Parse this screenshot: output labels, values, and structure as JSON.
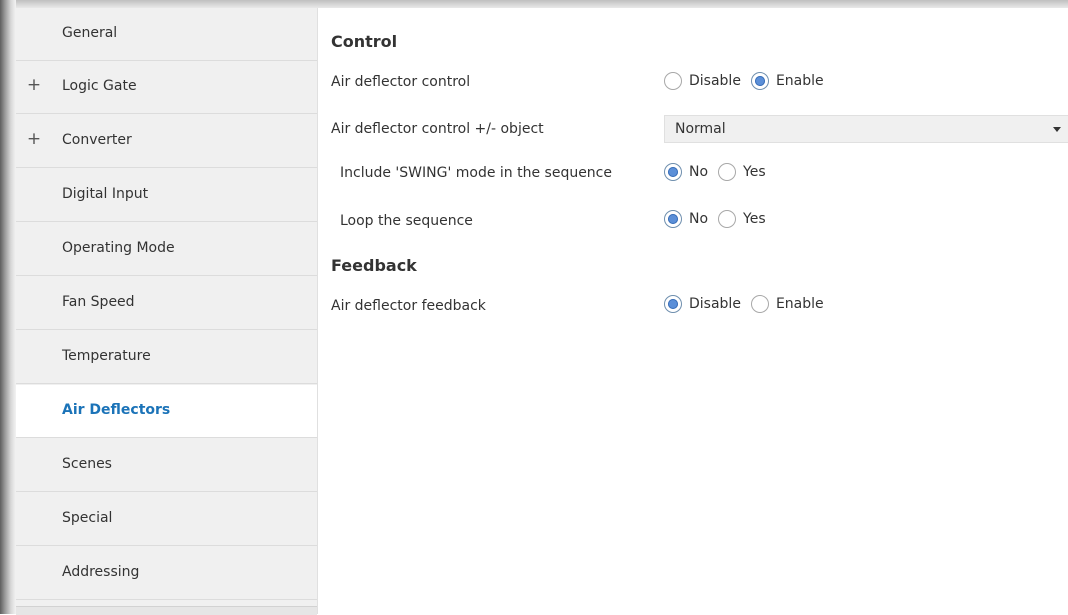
{
  "sidebar": {
    "items": [
      {
        "label": "General",
        "expand": ""
      },
      {
        "label": "Logic Gate",
        "expand": "+"
      },
      {
        "label": "Converter",
        "expand": "+"
      },
      {
        "label": "Digital Input",
        "expand": ""
      },
      {
        "label": "Operating Mode",
        "expand": ""
      },
      {
        "label": "Fan Speed",
        "expand": ""
      },
      {
        "label": "Temperature",
        "expand": ""
      },
      {
        "label": "Air Deflectors",
        "expand": ""
      },
      {
        "label": "Scenes",
        "expand": ""
      },
      {
        "label": "Special",
        "expand": ""
      },
      {
        "label": "Addressing",
        "expand": ""
      }
    ],
    "active_index": 7
  },
  "main": {
    "control": {
      "title": "Control",
      "deflector_control": {
        "label": "Air deflector control",
        "options": [
          "Disable",
          "Enable"
        ],
        "selected": "Enable"
      },
      "pm_object": {
        "label": "Air deflector control +/- object",
        "value": "Normal"
      },
      "swing": {
        "label": "Include 'SWING' mode in the sequence",
        "options": [
          "No",
          "Yes"
        ],
        "selected": "No"
      },
      "loop": {
        "label": "Loop the sequence",
        "options": [
          "No",
          "Yes"
        ],
        "selected": "No"
      }
    },
    "feedback": {
      "title": "Feedback",
      "deflector_feedback": {
        "label": "Air deflector feedback",
        "options": [
          "Disable",
          "Enable"
        ],
        "selected": "Disable"
      }
    }
  },
  "colors": {
    "active_nav": "#1b73b8",
    "radio_selected": "#5b8fd8",
    "sidebar_bg": "#f0f0f0"
  }
}
